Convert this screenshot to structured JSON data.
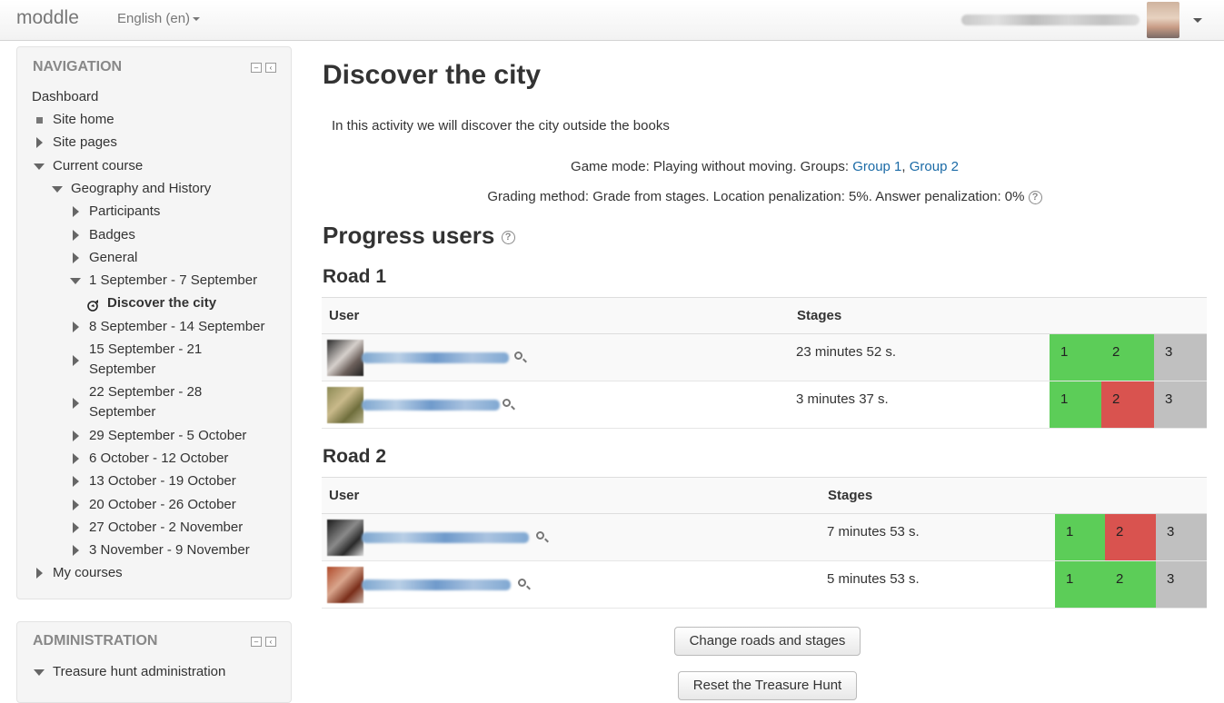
{
  "topbar": {
    "brand": "moddle",
    "language": "English (en)"
  },
  "navigation": {
    "title": "NAVIGATION",
    "items": {
      "dashboard": "Dashboard",
      "site_home": "Site home",
      "site_pages": "Site pages",
      "current_course": "Current course",
      "course": "Geography and History",
      "participants": "Participants",
      "badges": "Badges",
      "general": "General",
      "week1": "1 September - 7 September",
      "activity": "Discover the city",
      "week2": "8 September - 14 September",
      "week3_a": "15 September - 21",
      "week3_b": "September",
      "week4_a": "22 September - 28",
      "week4_b": "September",
      "week5": "29 September - 5 October",
      "week6": "6 October - 12 October",
      "week7": "13 October - 19 October",
      "week8": "20 October - 26 October",
      "week9": "27 October - 2 November",
      "week10": "3 November - 9 November",
      "my_courses": "My courses"
    }
  },
  "administration": {
    "title": "ADMINISTRATION",
    "treasure_hunt_admin": "Treasure hunt administration"
  },
  "main": {
    "title": "Discover the city",
    "intro": "In this activity we will discover the city outside the books",
    "game_mode_prefix": "Game mode: Playing without moving. Groups: ",
    "group1": "Group 1",
    "group_sep": ", ",
    "group2": "Group 2",
    "grading": "Grading method: Grade from stages. Location penalization: 5%. Answer penalization: 0%",
    "progress_title": "Progress users",
    "col_user": "User",
    "col_stages": "Stages",
    "roads": [
      {
        "name": "Road 1",
        "rows": [
          {
            "time": "23 minutes 52 s.",
            "stages": [
              "1",
              "2",
              "3"
            ]
          },
          {
            "time": "3 minutes 37 s.",
            "stages": [
              "1",
              "2",
              "3"
            ]
          }
        ]
      },
      {
        "name": "Road 2",
        "rows": [
          {
            "time": "7 minutes 53 s.",
            "stages": [
              "1",
              "2",
              "3"
            ]
          },
          {
            "time": "5 minutes 53 s.",
            "stages": [
              "1",
              "2",
              "3"
            ]
          }
        ]
      }
    ],
    "btn_change": "Change roads and stages",
    "btn_reset": "Reset the Treasure Hunt"
  },
  "colors": {
    "success": "#5ccd58",
    "failed": "#d9534f",
    "pending": "#c0c0c0",
    "link": "#1a6aa6"
  },
  "icons": [
    "help-icon",
    "magnifier-icon",
    "treasure-hunt-icon",
    "dock-block-icon",
    "hide-block-icon"
  ]
}
